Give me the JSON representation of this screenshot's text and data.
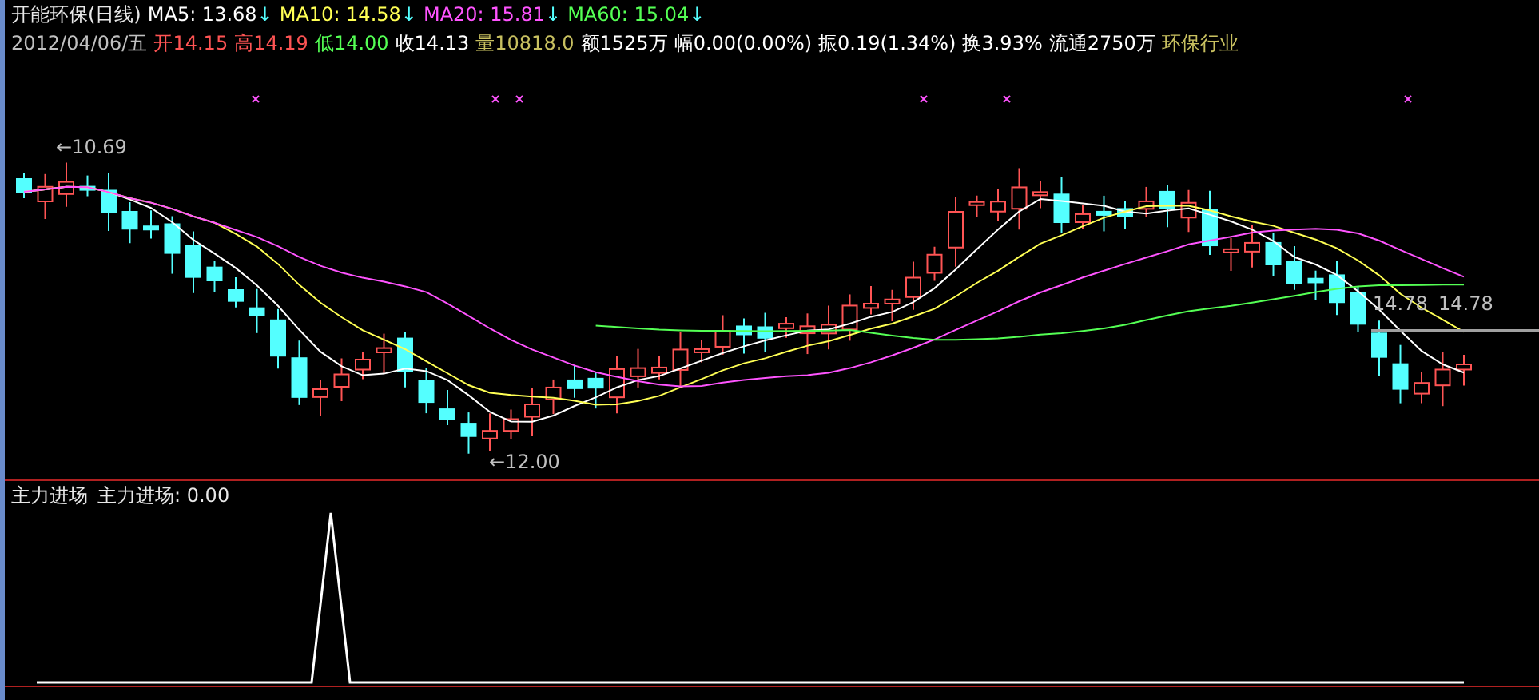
{
  "header": {
    "stock_name": "开能环保(日线)",
    "moving_averages": [
      {
        "label": "MA5:",
        "value": "13.68",
        "arrow": "↓",
        "color": "#ffffff"
      },
      {
        "label": "MA10:",
        "value": "14.58",
        "arrow": "↓",
        "color": "#ffff54"
      },
      {
        "label": "MA20:",
        "value": "15.81",
        "arrow": "↓",
        "color": "#ff54ff"
      },
      {
        "label": "MA60:",
        "value": "15.04",
        "arrow": "↓",
        "color": "#54ff54"
      }
    ],
    "date": "2012/04/06/五",
    "quote_fields": [
      {
        "label": "开",
        "value": "14.15",
        "color": "#ff5454"
      },
      {
        "label": "高",
        "value": "14.19",
        "color": "#ff5454"
      },
      {
        "label": "低",
        "value": "14.00",
        "color": "#54ff54"
      },
      {
        "label": "收",
        "value": "14.13",
        "color": "#ffffff"
      },
      {
        "label": "量",
        "value": "10818.0",
        "color": "#c8c060"
      },
      {
        "label": "额",
        "value": "1525万",
        "color": "#ffffff"
      },
      {
        "label": "幅",
        "value": "0.00(0.00%)",
        "color": "#ffffff"
      },
      {
        "label": "振",
        "value": "0.19(1.34%)",
        "color": "#ffffff"
      },
      {
        "label": "换",
        "value": "3.93%",
        "color": "#ffffff"
      },
      {
        "label": "流通",
        "value": "2750万",
        "color": "#ffffff"
      }
    ],
    "industry": "环保行业"
  },
  "price_chart": {
    "price_labels": [
      {
        "text": "10.69",
        "arrow": "←"
      },
      {
        "text": "12.00",
        "arrow": "←"
      },
      {
        "text": "14.78"
      },
      {
        "text": "14.78"
      }
    ]
  },
  "indicator": {
    "title": "主力进场",
    "reading_label": "主力进场:",
    "reading_value": "0.00"
  }
}
